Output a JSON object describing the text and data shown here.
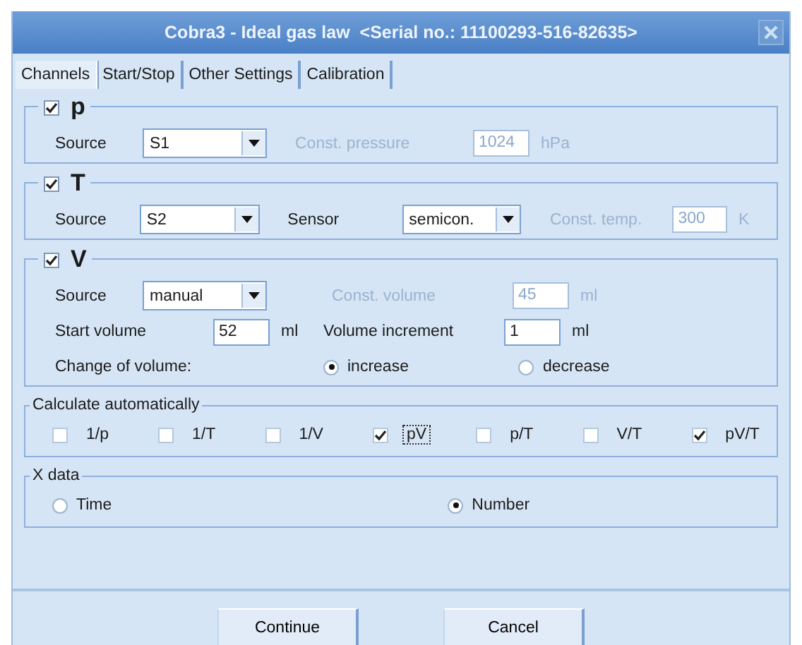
{
  "window": {
    "title": "Cobra3 - Ideal gas law  <Serial no.: 11100293-516-82635>"
  },
  "tabs": [
    {
      "label": "Channels",
      "selected": true
    },
    {
      "label": "Start/Stop",
      "selected": false
    },
    {
      "label": "Other Settings",
      "selected": false
    },
    {
      "label": "Calibration",
      "selected": false
    }
  ],
  "channels": [
    {
      "symbol": "p",
      "checked": true,
      "source": {
        "label": "Source",
        "value": "S1"
      },
      "constant": {
        "label": "Const. pressure",
        "value": "1024",
        "unit": "hPa",
        "disabled": true
      }
    },
    {
      "symbol": "T",
      "checked": true,
      "source": {
        "label": "Source",
        "value": "S2"
      },
      "sensor": {
        "label": "Sensor",
        "value": "semicon."
      },
      "constant": {
        "label": "Const. temp.",
        "value": "300",
        "unit": "K",
        "disabled": true
      }
    },
    {
      "symbol": "V",
      "checked": true,
      "source": {
        "label": "Source",
        "value": "manual"
      },
      "constant": {
        "label": "Const. volume",
        "value": "45",
        "unit": "ml",
        "disabled": true
      },
      "start_volume": {
        "label": "Start volume",
        "value": "52",
        "unit": "ml"
      },
      "increment": {
        "label": "Volume increment",
        "value": "1",
        "unit": "ml"
      },
      "change": {
        "label": "Change of volume:",
        "options": [
          {
            "label": "increase",
            "selected": true
          },
          {
            "label": "decrease",
            "selected": false
          }
        ]
      }
    }
  ],
  "calculate": {
    "title": "Calculate automatically",
    "options": [
      {
        "label": "1/p",
        "checked": false,
        "focused": false
      },
      {
        "label": "1/T",
        "checked": false,
        "focused": false
      },
      {
        "label": "1/V",
        "checked": false,
        "focused": false
      },
      {
        "label": "pV",
        "checked": true,
        "focused": true
      },
      {
        "label": "p/T",
        "checked": false,
        "focused": false
      },
      {
        "label": "V/T",
        "checked": false,
        "focused": false
      },
      {
        "label": "pV/T",
        "checked": true,
        "focused": false
      }
    ]
  },
  "x_data": {
    "title": "X data",
    "options": [
      {
        "label": "Time",
        "selected": false
      },
      {
        "label": "Number",
        "selected": true
      }
    ]
  },
  "buttons": [
    "Continue",
    "Cancel"
  ]
}
